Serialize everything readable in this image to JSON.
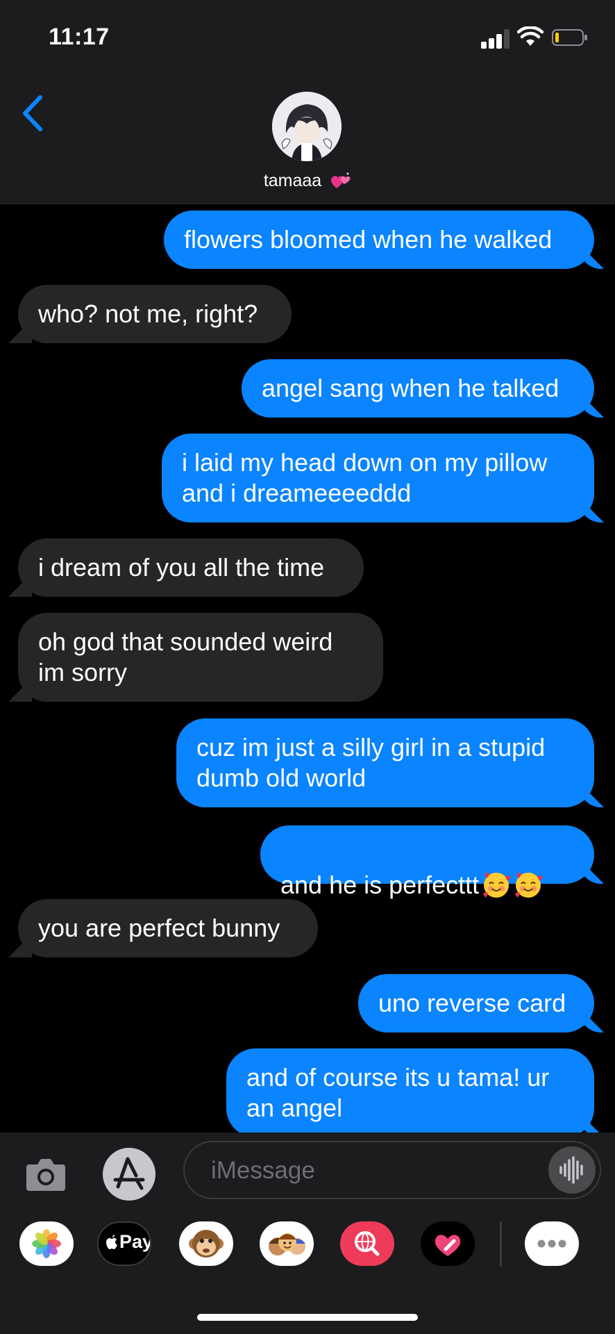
{
  "status": {
    "time": "11:17"
  },
  "contact": {
    "name": "tamaaa"
  },
  "messages": [
    {
      "side": "sent",
      "text": "flowers bloomed when he walked"
    },
    {
      "side": "recv",
      "text": "who? not me, right?"
    },
    {
      "side": "sent",
      "text": "angel sang when he talked"
    },
    {
      "side": "sent",
      "text": "i laid my head down on my pillow\nand i dreameeeeddd"
    },
    {
      "side": "recv",
      "text": "i dream of you all the time"
    },
    {
      "side": "recv",
      "text": "oh god that sounded weird\nim sorry"
    },
    {
      "side": "sent",
      "text": "cuz im just a silly girl in a stupid\ndumb old world"
    },
    {
      "side": "sent",
      "text": "and he is perfecttt"
    },
    {
      "side": "recv",
      "text": "you are perfect bunny"
    },
    {
      "side": "sent",
      "text": "uno reverse card"
    },
    {
      "side": "sent",
      "text": "and of course its u tama! ur\nan angel"
    }
  ],
  "composer": {
    "placeholder": "iMessage"
  },
  "apps": {
    "apple_pay": "Pay"
  },
  "colors": {
    "sent_bubble": "#0a84ff",
    "received_bubble": "#262629",
    "background": "#000000",
    "bar": "#1c1c1e"
  },
  "icons": [
    "back-chevron-icon",
    "camera-icon",
    "app-store-icon",
    "audio-waveform-icon",
    "photos-icon",
    "apple-pay-icon",
    "monkey-animoji-icon",
    "memoji-icon",
    "web-search-icon",
    "digital-touch-icon",
    "more-icon",
    "heart-emoji-icon",
    "smiling-hearts-emoji-icon"
  ]
}
